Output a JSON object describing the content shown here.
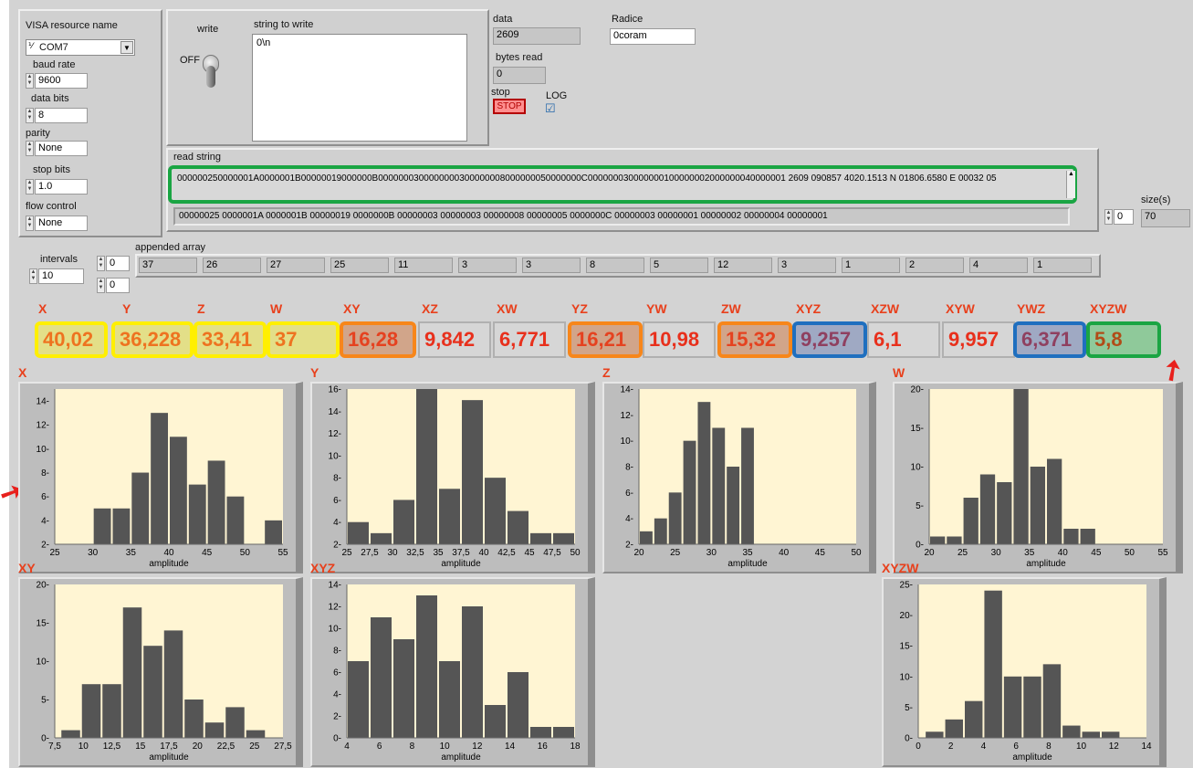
{
  "visa": {
    "title": "VISA resource name",
    "resource": "COM7",
    "baud_label": "baud rate",
    "baud": "9600",
    "databits_label": "data bits",
    "databits": "8",
    "parity_label": "parity",
    "parity": "None",
    "stopbits_label": "stop bits",
    "stopbits": "1.0",
    "flow_label": "flow control",
    "flow": "None"
  },
  "write": {
    "label": "write",
    "off_label": "OFF",
    "string_label": "string to write",
    "string": "0\\n"
  },
  "data_panel": {
    "data_label": "data",
    "data": "2609",
    "radice_label": "Radice",
    "radice": "0coram",
    "bytes_label": "bytes read",
    "bytes": "0",
    "stop_label": "stop",
    "stop_button": "STOP",
    "log_label": "LOG",
    "log_checked": "☑"
  },
  "read_string": {
    "label": "read string",
    "line1": "000000250000001A0000001B00000019000000B0000000300000000300000008000000050000000C000000030000000100000002000000040000001  2609 090857 4020.1513 N 01806.6580 E 00032 05",
    "line2": "00000025 0000001A 0000001B 00000019 0000000B 00000003 00000003 00000008 00000005 0000000C 00000003 00000001 00000002 00000004 00000001"
  },
  "size": {
    "label": "size(s)",
    "index": "0",
    "value": "70"
  },
  "intervals": {
    "label": "intervals",
    "value": "10"
  },
  "appended": {
    "label": "appended array",
    "index1": "0",
    "index2": "0",
    "values": [
      "37",
      "26",
      "27",
      "25",
      "11",
      "3",
      "3",
      "8",
      "5",
      "12",
      "3",
      "1",
      "2",
      "4",
      "1"
    ]
  },
  "metrics": [
    {
      "label": "X",
      "value": "40,02",
      "hl": "Y"
    },
    {
      "label": "Y",
      "value": "36,228",
      "hl": "Y"
    },
    {
      "label": "Z",
      "value": "33,41",
      "hl": "Y"
    },
    {
      "label": "W",
      "value": "37",
      "hl": "Y"
    },
    {
      "label": "XY",
      "value": "16,28",
      "hl": "O"
    },
    {
      "label": "XZ",
      "value": "9,842",
      "hl": ""
    },
    {
      "label": "XW",
      "value": "6,771",
      "hl": ""
    },
    {
      "label": "YZ",
      "value": "16,21",
      "hl": "O"
    },
    {
      "label": "YW",
      "value": "10,98",
      "hl": ""
    },
    {
      "label": "ZW",
      "value": "15,32",
      "hl": "O"
    },
    {
      "label": "XYZ",
      "value": "9,257",
      "hl": "B"
    },
    {
      "label": "XZW",
      "value": "6,1",
      "hl": ""
    },
    {
      "label": "XYW",
      "value": "9,957",
      "hl": ""
    },
    {
      "label": "YWZ",
      "value": "6,371",
      "hl": "B"
    },
    {
      "label": "XYZW",
      "value": "5,8",
      "hl": "G"
    }
  ],
  "colors": {
    "accent": "#e8401c",
    "plot_bg": "#fff5d3",
    "bar": "#555555"
  },
  "chart_data": [
    {
      "title": "X",
      "type": "bar",
      "xlabel": "amplitude",
      "xlim": [
        25,
        55
      ],
      "ylim": [
        2,
        15
      ],
      "xticks": [
        "25",
        "30",
        "35",
        "40",
        "45",
        "50",
        "55"
      ],
      "yticks": [
        "2",
        "4",
        "6",
        "8",
        "10",
        "12",
        "14"
      ],
      "bin_edges": [
        27.5,
        30,
        32.5,
        35,
        37.5,
        40,
        42.5,
        45,
        47.5,
        50,
        52.5,
        55
      ],
      "values": [
        null,
        5,
        5,
        8,
        13,
        11,
        7,
        9,
        6,
        2,
        4
      ]
    },
    {
      "title": "Y",
      "type": "bar",
      "xlabel": "amplitude",
      "xlim": [
        25,
        50
      ],
      "ylim": [
        2,
        16
      ],
      "xticks": [
        "25",
        "27,5",
        "30",
        "32,5",
        "35",
        "37,5",
        "40",
        "42,5",
        "45",
        "47,5",
        "50"
      ],
      "yticks": [
        "2",
        "4",
        "6",
        "8",
        "10",
        "12",
        "14",
        "16"
      ],
      "bin_edges": [
        25,
        27.5,
        30,
        32.5,
        35,
        37.5,
        40,
        42.5,
        45,
        47.5,
        50
      ],
      "values": [
        4,
        3,
        6,
        16,
        7,
        15,
        8,
        5,
        3,
        3
      ]
    },
    {
      "title": "Z",
      "type": "bar",
      "xlabel": "amplitude",
      "xlim": [
        20,
        50
      ],
      "ylim": [
        2,
        14
      ],
      "xticks": [
        "20",
        "25",
        "30",
        "35",
        "40",
        "45",
        "50"
      ],
      "yticks": [
        "2",
        "4",
        "6",
        "8",
        "10",
        "12",
        "14"
      ],
      "bin_edges": [
        20,
        22,
        24,
        26,
        28,
        30,
        32,
        34,
        36,
        38,
        40,
        42,
        44,
        46
      ],
      "values": [
        3,
        4,
        6,
        10,
        13,
        11,
        8,
        11,
        2,
        2,
        2
      ]
    },
    {
      "title": "W",
      "type": "bar",
      "xlabel": "amplitude",
      "xlim": [
        20,
        55
      ],
      "ylim": [
        0,
        20
      ],
      "xticks": [
        "20",
        "25",
        "30",
        "35",
        "40",
        "45",
        "50",
        "55"
      ],
      "yticks": [
        "0",
        "5",
        "10",
        "15",
        "20"
      ],
      "bin_edges": [
        20,
        22.5,
        25,
        27.5,
        30,
        32.5,
        35,
        37.5,
        40,
        42.5,
        45,
        47.5,
        50
      ],
      "values": [
        1,
        1,
        6,
        9,
        8,
        20,
        10,
        11,
        2,
        2
      ]
    },
    {
      "title": "XY",
      "type": "bar",
      "xlabel": "amplitude",
      "xlim": [
        7.5,
        27.5
      ],
      "ylim": [
        0,
        20
      ],
      "xticks": [
        "7,5",
        "10",
        "12,5",
        "15",
        "17,5",
        "20",
        "22,5",
        "25",
        "27,5"
      ],
      "yticks": [
        "0",
        "5",
        "10",
        "15",
        "20"
      ],
      "bin_edges": [
        8,
        9.8,
        11.6,
        13.4,
        15.2,
        17,
        18.8,
        20.6,
        22.4,
        24.2,
        26
      ],
      "values": [
        1,
        7,
        7,
        17,
        12,
        14,
        5,
        2,
        4,
        1
      ]
    },
    {
      "title": "XYZ",
      "type": "bar",
      "xlabel": "amplitude",
      "xlim": [
        4,
        18
      ],
      "ylim": [
        0,
        14
      ],
      "xticks": [
        "4",
        "6",
        "8",
        "10",
        "12",
        "14",
        "16",
        "18"
      ],
      "yticks": [
        "0",
        "2",
        "4",
        "6",
        "8",
        "10",
        "12",
        "14"
      ],
      "bin_edges": [
        4,
        5.4,
        6.8,
        8.2,
        9.6,
        11,
        12.4,
        13.8,
        15.2,
        16.6,
        18
      ],
      "values": [
        7,
        11,
        9,
        13,
        7,
        12,
        3,
        6,
        1,
        1
      ]
    },
    {
      "title": "XYZW",
      "type": "bar",
      "xlabel": "amplitude",
      "xlim": [
        0,
        14
      ],
      "ylim": [
        0,
        25
      ],
      "xticks": [
        "0",
        "2",
        "4",
        "6",
        "8",
        "10",
        "12",
        "14"
      ],
      "yticks": [
        "0",
        "5",
        "10",
        "15",
        "20",
        "25"
      ],
      "bin_edges": [
        0.4,
        1.6,
        2.8,
        4,
        5.2,
        6.4,
        7.6,
        8.8,
        10,
        11.2,
        12.4
      ],
      "values": [
        1,
        3,
        6,
        24,
        10,
        10,
        12,
        2,
        1,
        1
      ]
    }
  ]
}
